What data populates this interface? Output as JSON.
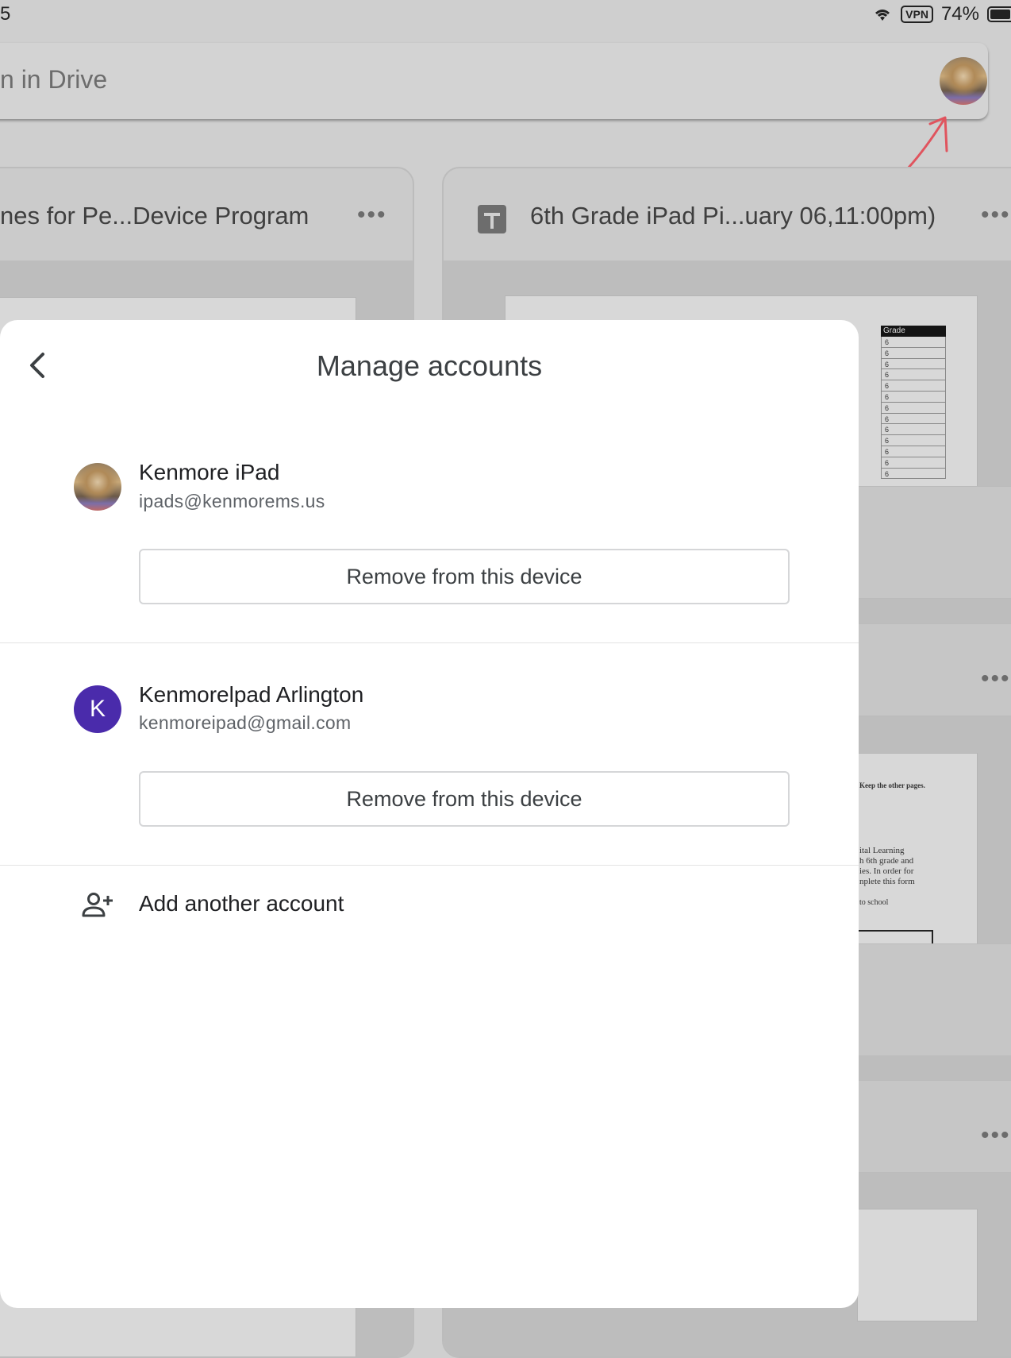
{
  "status_bar": {
    "time_fragment": "5",
    "vpn": "VPN",
    "battery": "74%",
    "battery_level": 0.74
  },
  "search": {
    "placeholder_fragment": "n in Drive"
  },
  "files": [
    {
      "title": "nes for Pe...Device Program",
      "menu": "•••"
    },
    {
      "title": "6th Grade iPad Pi...uary 06,11:00pm)",
      "menu": "•••",
      "icon": "sheets-icon"
    }
  ],
  "bg_doc": {
    "grid_header": "Grade",
    "grid_values": [
      "6",
      "6",
      "6",
      "6",
      "6",
      "6",
      "6",
      "6",
      "6",
      "6",
      "6",
      "6",
      "6"
    ],
    "text_lines": [
      "Keep the other pages.",
      "",
      "ital Learning",
      "h 6th grade and",
      "ies. In order for",
      "nplete this form",
      "",
      "to school"
    ],
    "row_menus": [
      "•••",
      "•••"
    ]
  },
  "dialog": {
    "title": "Manage accounts",
    "accounts": [
      {
        "name": "Kenmore iPad",
        "email": "ipads@kenmorems.us",
        "avatar": "photo",
        "remove_label": "Remove from this device"
      },
      {
        "name": "Kenmorelpad Arlington",
        "email": "kenmoreipad@gmail.com",
        "avatar_letter": "K",
        "avatar_color": "#4a2bab",
        "remove_label": "Remove from this device"
      }
    ],
    "add_account_label": "Add another account"
  },
  "colors": {
    "annotation_arrow": "#e0545e",
    "accent": "#4a2bab"
  }
}
